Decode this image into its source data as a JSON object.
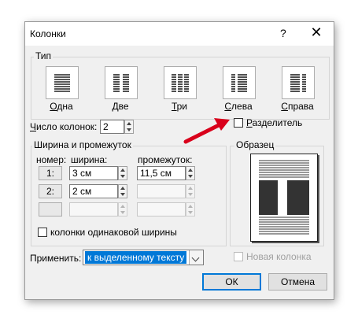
{
  "dialog": {
    "title": "Колонки",
    "help_label": "?",
    "close_label": "✕"
  },
  "presets": {
    "group_label": "Тип",
    "items": [
      {
        "first": "О",
        "rest": "дна"
      },
      {
        "first": "Д",
        "rest": "ве"
      },
      {
        "first": "Т",
        "rest": "ри"
      },
      {
        "first": "С",
        "rest": "лева"
      },
      {
        "first": "С",
        "rest": "права"
      }
    ]
  },
  "num_columns": {
    "label_first": "Ч",
    "label_rest": "исло колонок:",
    "value": "2"
  },
  "separator": {
    "label_first": "Р",
    "label_rest": "азделитель",
    "checked": false
  },
  "width_spacing": {
    "group_label": "Ширина и промежуток",
    "col_number_label": "номер:",
    "width_label": "ширина:",
    "spacing_label": "промежуток:",
    "rows": [
      {
        "number": "1:",
        "width": "3 см",
        "spacing": "11,5 см"
      },
      {
        "number": "2:",
        "width": "2 см",
        "spacing": ""
      },
      {
        "number": "",
        "width": "",
        "spacing": ""
      }
    ]
  },
  "equal_width": {
    "label": "колонки одинаковой ширины",
    "checked": false
  },
  "preview": {
    "group_label": "Образец"
  },
  "apply": {
    "label": "Применить:",
    "value": "к выделенному тексту"
  },
  "new_column": {
    "label": "Новая колонка",
    "checked": false
  },
  "buttons": {
    "ok": "ОК",
    "cancel": "Отмена"
  },
  "colors": {
    "accent": "#0078d7",
    "arrow": "#d9001b"
  }
}
